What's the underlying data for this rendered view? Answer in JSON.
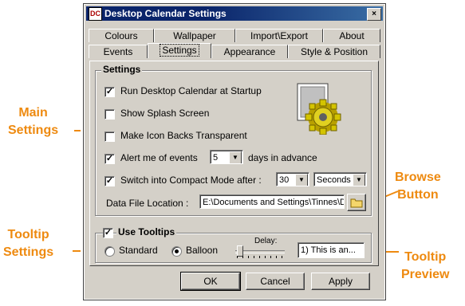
{
  "window": {
    "title": "Desktop Calendar Settings",
    "close_glyph": "×",
    "icon_text": "DC"
  },
  "tabs": {
    "row1": [
      "Colours",
      "Wallpaper",
      "Import\\Export",
      "About"
    ],
    "row2": [
      "Events",
      "Settings",
      "Appearance",
      "Style & Position"
    ],
    "active": "Settings"
  },
  "settings_group": {
    "label": "Settings",
    "run_at_startup": {
      "label": "Run Desktop Calendar at Startup",
      "checked": true
    },
    "show_splash": {
      "label": "Show Splash Screen",
      "checked": false
    },
    "transparent_icons": {
      "label": "Make Icon Backs Transparent",
      "checked": false
    },
    "alert": {
      "label": "Alert me of events",
      "checked": true,
      "value": "5",
      "suffix": "days in advance"
    },
    "compact": {
      "label": "Switch into Compact Mode after :",
      "checked": true,
      "value": "30",
      "unit": "Seconds"
    },
    "data_file": {
      "label": "Data File Location :",
      "value": "E:\\Documents and Settings\\Tinnes\\De"
    }
  },
  "tooltip_group": {
    "label": "Use Tooltips",
    "checked": true,
    "standard_label": "Standard",
    "balloon_label": "Balloon",
    "selected": "Balloon",
    "delay_label": "Delay:",
    "preview_text": "1)   This is an..."
  },
  "buttons": {
    "ok": "OK",
    "cancel": "Cancel",
    "apply": "Apply"
  },
  "annotations": {
    "main_settings": [
      "Main",
      "Settings"
    ],
    "tooltip_settings": [
      "Tooltip",
      "Settings"
    ],
    "browse_button": [
      "Browse",
      "Button"
    ],
    "tooltip_preview": [
      "Tooltip",
      "Preview"
    ]
  },
  "colors": {
    "annotation": "#ee8a10",
    "titlebar": "#0a246a",
    "dialog_bg": "#d4d0c8"
  },
  "icons": {
    "checkmark": "✓",
    "dropdown": "▼",
    "folder": "folder-icon",
    "gear": "gear-icon"
  }
}
